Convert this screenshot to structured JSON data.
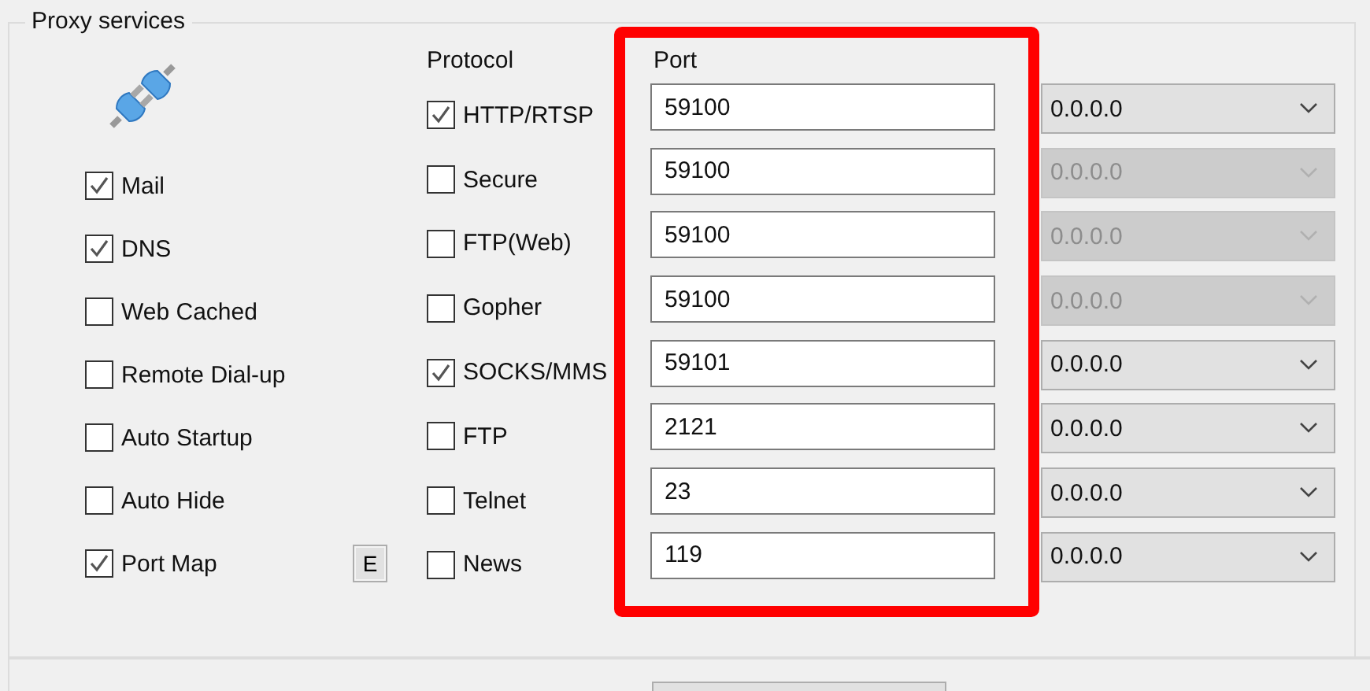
{
  "group": {
    "title": "Proxy services"
  },
  "options": [
    {
      "label": "Mail",
      "checked": true
    },
    {
      "label": "DNS",
      "checked": true
    },
    {
      "label": "Web Cached",
      "checked": false
    },
    {
      "label": "Remote Dial-up",
      "checked": false
    },
    {
      "label": "Auto Startup",
      "checked": false
    },
    {
      "label": "Auto Hide",
      "checked": false
    },
    {
      "label": "Port Map",
      "checked": true
    }
  ],
  "port_map_button": {
    "label": "E"
  },
  "protocol_header": "Protocol",
  "port_header": "Port",
  "protocols": [
    {
      "label": "HTTP/RTSP",
      "checked": true,
      "port": "59100",
      "address": "0.0.0.0",
      "address_disabled": false
    },
    {
      "label": "Secure",
      "checked": false,
      "port": "59100",
      "address": "0.0.0.0",
      "address_disabled": true
    },
    {
      "label": "FTP(Web)",
      "checked": false,
      "port": "59100",
      "address": "0.0.0.0",
      "address_disabled": true
    },
    {
      "label": "Gopher",
      "checked": false,
      "port": "59100",
      "address": "0.0.0.0",
      "address_disabled": true
    },
    {
      "label": "SOCKS/MMS",
      "checked": true,
      "port": "59101",
      "address": "0.0.0.0",
      "address_disabled": false
    },
    {
      "label": "FTP",
      "checked": false,
      "port": "2121",
      "address": "0.0.0.0",
      "address_disabled": false
    },
    {
      "label": "Telnet",
      "checked": false,
      "port": "23",
      "address": "0.0.0.0",
      "address_disabled": false
    },
    {
      "label": "News",
      "checked": false,
      "port": "119",
      "address": "0.0.0.0",
      "address_disabled": false
    }
  ]
}
